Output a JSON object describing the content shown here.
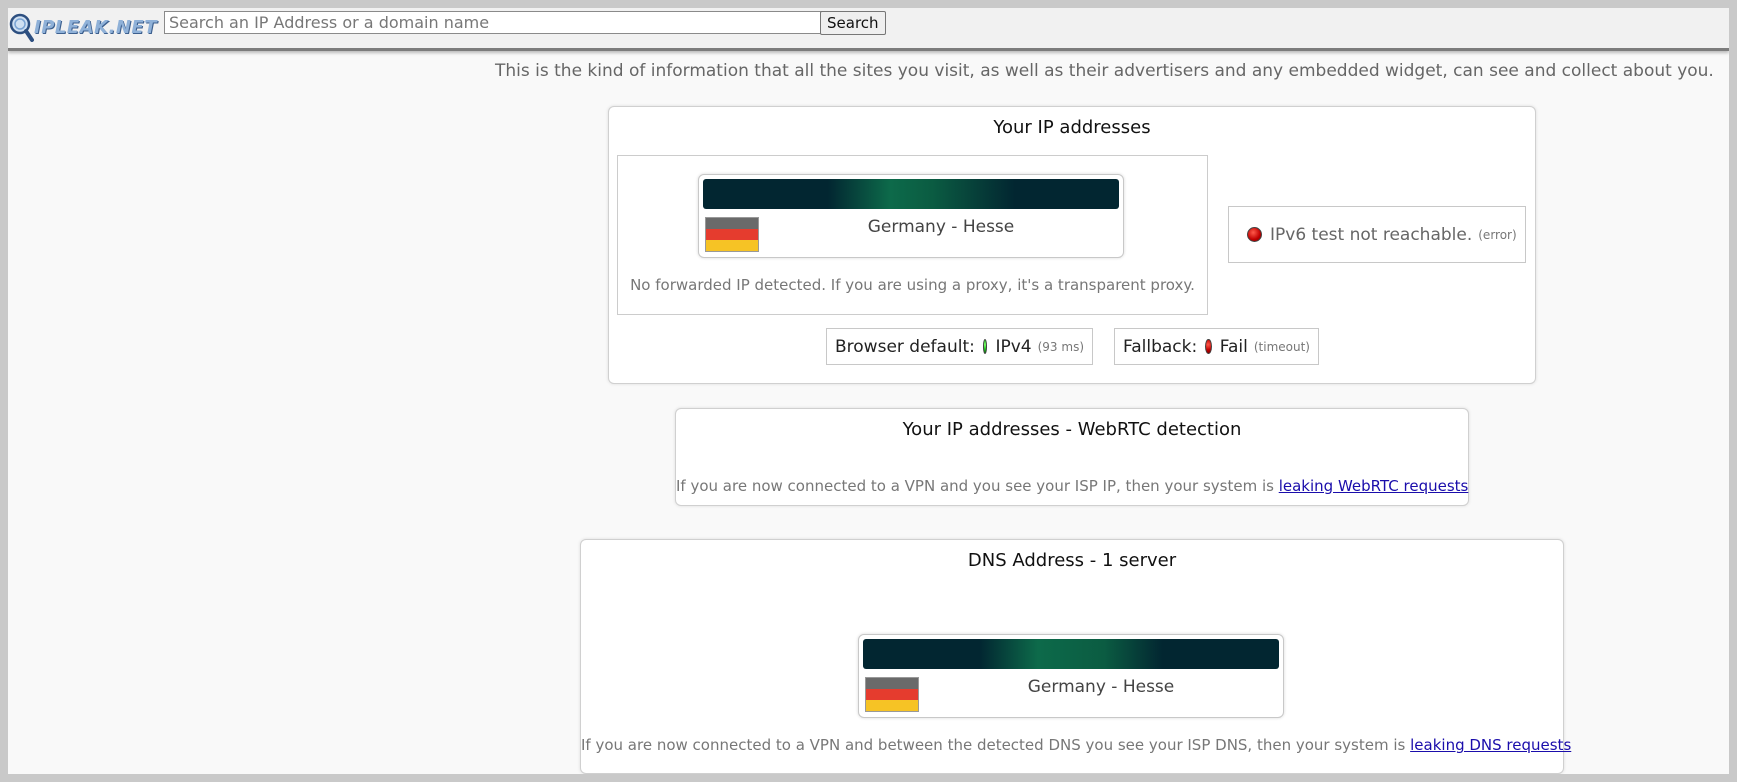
{
  "header": {
    "logo_text": "IPLEAK.NET",
    "search_placeholder": "Search an IP Address or a domain name",
    "search_button": "Search"
  },
  "intro": "This is the kind of information that all the sites you visit, as well as their advertisers and any embedded widget, can see and collect about you.",
  "ip_section": {
    "title": "Your IP addresses",
    "location": "Germany - Hesse",
    "forwarded_note": "No forwarded IP detected. If you are using a proxy, it's a transparent proxy.",
    "ipv6": {
      "text": "IPv6 test not reachable.",
      "note": "(error)"
    },
    "browser_default": {
      "label": "Browser default:",
      "value": "IPv4",
      "note": "(93 ms)"
    },
    "fallback": {
      "label": "Fallback:",
      "value": "Fail",
      "note": "(timeout)"
    }
  },
  "webrtc_section": {
    "title": "Your IP addresses - WebRTC detection",
    "note": "If you are now connected to a VPN and you see your ISP IP, then your system is",
    "link": "leaking WebRTC requests"
  },
  "dns_section": {
    "title": "DNS Address - 1 server",
    "location": "Germany - Hesse",
    "note": "If you are now connected to a VPN and between the detected DNS you see your ISP DNS, then your system is",
    "link": "leaking DNS requests"
  },
  "colors": {
    "status_ok": "#15b815",
    "status_error": "#c00000",
    "link": "#1a0dab"
  },
  "icons": [
    "magnifier-logo-icon",
    "germany-flag-icon",
    "red-status-dot-icon",
    "green-status-dot-icon"
  ]
}
